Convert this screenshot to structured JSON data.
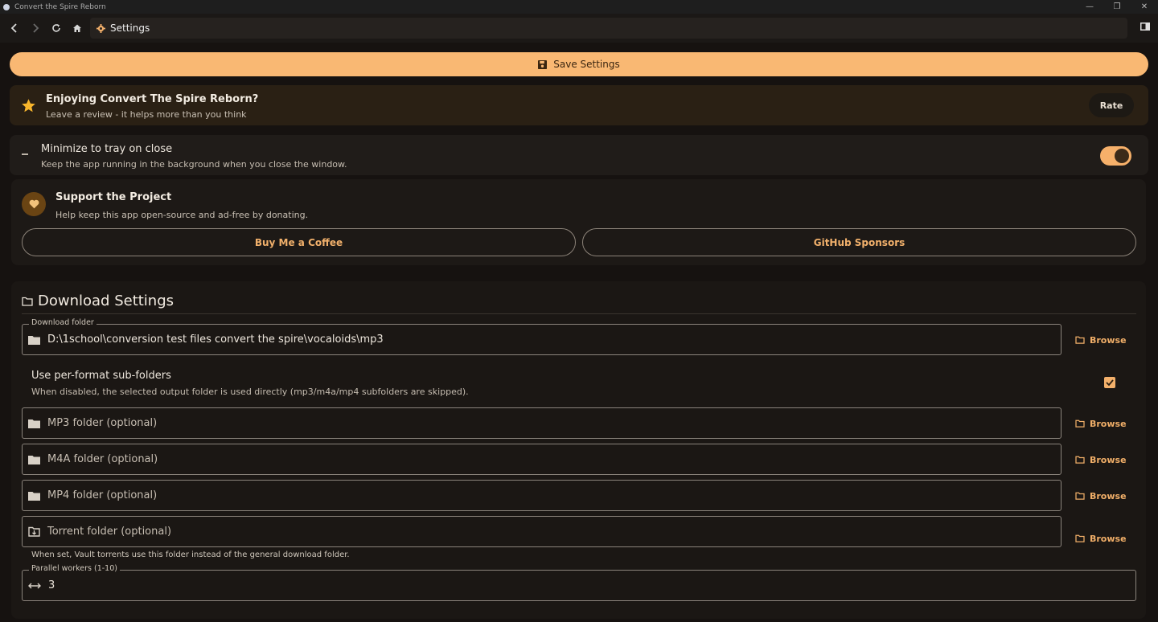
{
  "window": {
    "title": "Convert the Spire Reborn",
    "controls": [
      "minimize",
      "restore",
      "close"
    ]
  },
  "nav": {
    "page_label": "Settings"
  },
  "save": {
    "label": "Save Settings"
  },
  "review": {
    "heading": "Enjoying Convert The Spire Reborn?",
    "subtext": "Leave a review - it helps more than you think",
    "button": "Rate"
  },
  "tray": {
    "heading": "Minimize to tray on close",
    "subtext": "Keep the app running in the background when you close the window.",
    "enabled": true
  },
  "support": {
    "heading": "Support the Project",
    "subtext": "Help keep this app open-source and ad-free by donating.",
    "buttons": [
      "Buy Me a Coffee",
      "GitHub Sponsors"
    ]
  },
  "download": {
    "title": "Download Settings",
    "folder_label": "Download folder",
    "folder_value": "D:\\1school\\conversion test files convert the spire\\vocaloids\\mp3",
    "browse_label": "Browse",
    "performat_heading": "Use per-format sub-folders",
    "performat_subtext": "When disabled, the selected output folder is used directly (mp3/m4a/mp4 subfolders are skipped).",
    "performat_checked": true,
    "mp3_placeholder": "MP3 folder (optional)",
    "m4a_placeholder": "M4A folder (optional)",
    "mp4_placeholder": "MP4 folder (optional)",
    "torrent_placeholder": "Torrent folder (optional)",
    "torrent_help": "When set, Vault torrents use this folder instead of the general download folder.",
    "workers_label": "Parallel workers (1-10)",
    "workers_value": "3"
  },
  "colors": {
    "accent": "#f9b873",
    "background": "#161210",
    "review_card": "#2a2014"
  }
}
